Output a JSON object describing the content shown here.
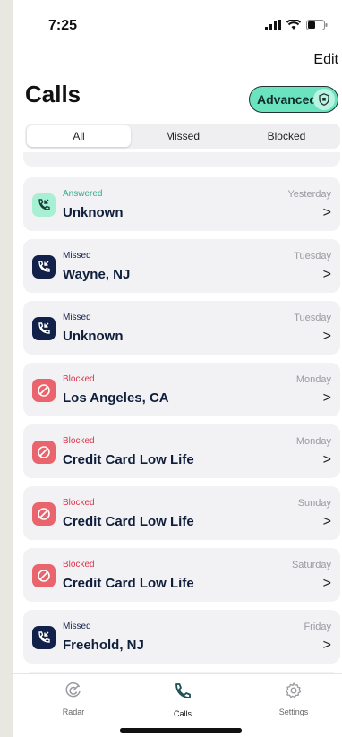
{
  "status_bar": {
    "time": "7:25"
  },
  "header": {
    "edit_label": "Edit",
    "title": "Calls",
    "advanced_label": "Advanced"
  },
  "segments": [
    {
      "label": "All",
      "active": true
    },
    {
      "label": "Missed",
      "active": false
    },
    {
      "label": "Blocked",
      "active": false
    }
  ],
  "calls": [
    {
      "status": "Answered",
      "name": "Unknown",
      "day": "Yesterday",
      "chevron": ">",
      "type": "answered"
    },
    {
      "status": "Missed",
      "name": "Wayne, NJ",
      "day": "Tuesday",
      "chevron": ">",
      "type": "missed"
    },
    {
      "status": "Missed",
      "name": "Unknown",
      "day": "Tuesday",
      "chevron": ">",
      "type": "missed"
    },
    {
      "status": "Blocked",
      "name": "Los Angeles, CA",
      "day": "Monday",
      "chevron": ">",
      "type": "blocked"
    },
    {
      "status": "Blocked",
      "name": "Credit Card Low Life",
      "day": "Monday",
      "chevron": ">",
      "type": "blocked"
    },
    {
      "status": "Blocked",
      "name": "Credit Card Low Life",
      "day": "Sunday",
      "chevron": ">",
      "type": "blocked"
    },
    {
      "status": "Blocked",
      "name": "Credit Card Low Life",
      "day": "Saturday",
      "chevron": ">",
      "type": "blocked"
    },
    {
      "status": "Missed",
      "name": "Freehold, NJ",
      "day": "Friday",
      "chevron": ">",
      "type": "missed"
    }
  ],
  "status_colors": {
    "answered": "#3aa889",
    "missed": "#12214a",
    "blocked": "#e0324a"
  },
  "tabs": [
    {
      "label": "Radar",
      "icon": "radar-icon",
      "active": false
    },
    {
      "label": "Calls",
      "icon": "phone-icon",
      "active": true
    },
    {
      "label": "Settings",
      "icon": "gear-icon",
      "active": false
    }
  ]
}
